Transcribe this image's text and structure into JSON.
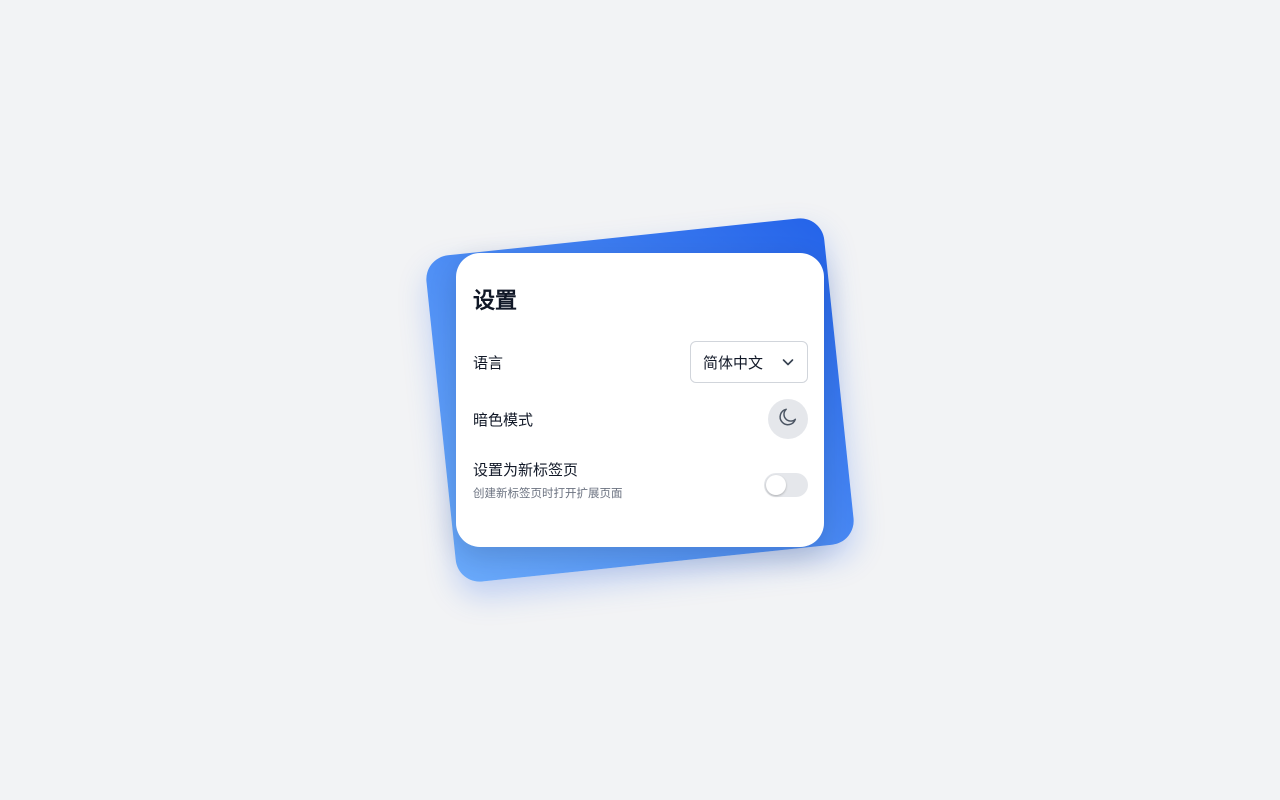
{
  "settings": {
    "title": "设置",
    "language": {
      "label": "语言",
      "selected": "简体中文"
    },
    "dark_mode": {
      "label": "暗色模式",
      "icon": "moon-icon",
      "enabled": false
    },
    "new_tab": {
      "label": "设置为新标签页",
      "description": "创建新标签页时打开扩展页面",
      "enabled": false
    }
  },
  "colors": {
    "accent_start": "#6aaafb",
    "accent_end": "#2463e9",
    "page_background": "#f2f3f5",
    "card_background": "#ffffff"
  }
}
